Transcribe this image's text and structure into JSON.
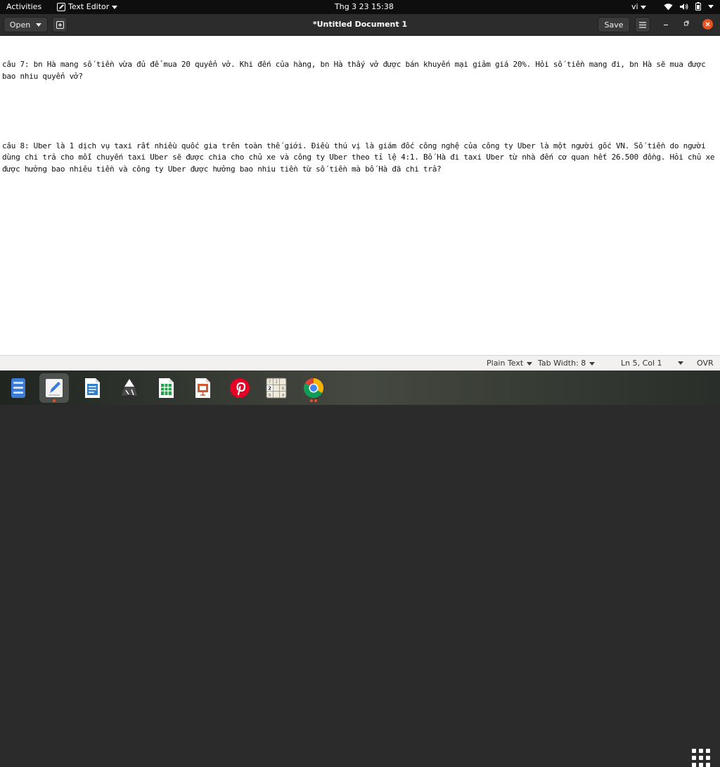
{
  "topbar": {
    "activities": "Activities",
    "app_name": "Text Editor",
    "clock": "Thg 3 23  15:38",
    "input_lang": "vi"
  },
  "header": {
    "open_label": "Open",
    "title": "*Untitled Document 1",
    "save_label": "Save"
  },
  "editor": {
    "lines": [
      "câu 7: bn Hà mang số tiền vừa đủ để mua 20 quyển vở. Khi đến của hàng, bn Hà thấy vở được bán khuyến mại giảm giá 20%. Hỏi số tiền mang đi, bn Hà sẽ mua được bao nhiu quyển vở?",
      "",
      "câu 8: Uber là 1 dịch vụ taxi rất nhiều quốc gia trên toàn thế giới. Điều thú vị là giám đốc công nghệ của công ty Uber là một người gốc VN. Số tiền do người dùng chi trả cho mỗi chuyến taxi Uber sẽ được chia cho chủ xe và công ty Uber theo tỉ lệ 4:1. Bố Hà đi taxi Uber từ nhà đến cơ quan hết 26.500 đồng. Hỏi chủ xe được hưởng bao nhiêu tiền và công ty Uber được hưởng bao nhiu tiền từ số tiền mà bố Hà đã chi trả?"
    ]
  },
  "statusbar": {
    "language": "Plain Text",
    "tab_width": "Tab Width: 8",
    "cursor": "Ln 5, Col 1",
    "mode": "OVR"
  },
  "dock": {
    "items": [
      {
        "name": "files-icon",
        "color": "#3d7bd9"
      },
      {
        "name": "text-editor-icon",
        "color": "#f4f4f4"
      },
      {
        "name": "libreoffice-writer-icon",
        "color": "#2f7fd1"
      },
      {
        "name": "inkscape-icon",
        "color": "#4b4b4b"
      },
      {
        "name": "libreoffice-calc-icon",
        "color": "#21a24b"
      },
      {
        "name": "libreoffice-impress-icon",
        "color": "#d2592c"
      },
      {
        "name": "pinterest-icon",
        "color": "#e60023"
      },
      {
        "name": "sudoku-icon",
        "color": "#f0ead8"
      },
      {
        "name": "chrome-icon",
        "color": "#4285f4"
      }
    ],
    "sudoku_digits": [
      "7",
      "1",
      "2",
      "6",
      "9",
      "4"
    ]
  },
  "colors": {
    "accent": "#e95420",
    "topbar_bg": "#0e0e0e",
    "headerbar_bg": "#2c2c2c",
    "editor_bg": "#ffffff"
  }
}
